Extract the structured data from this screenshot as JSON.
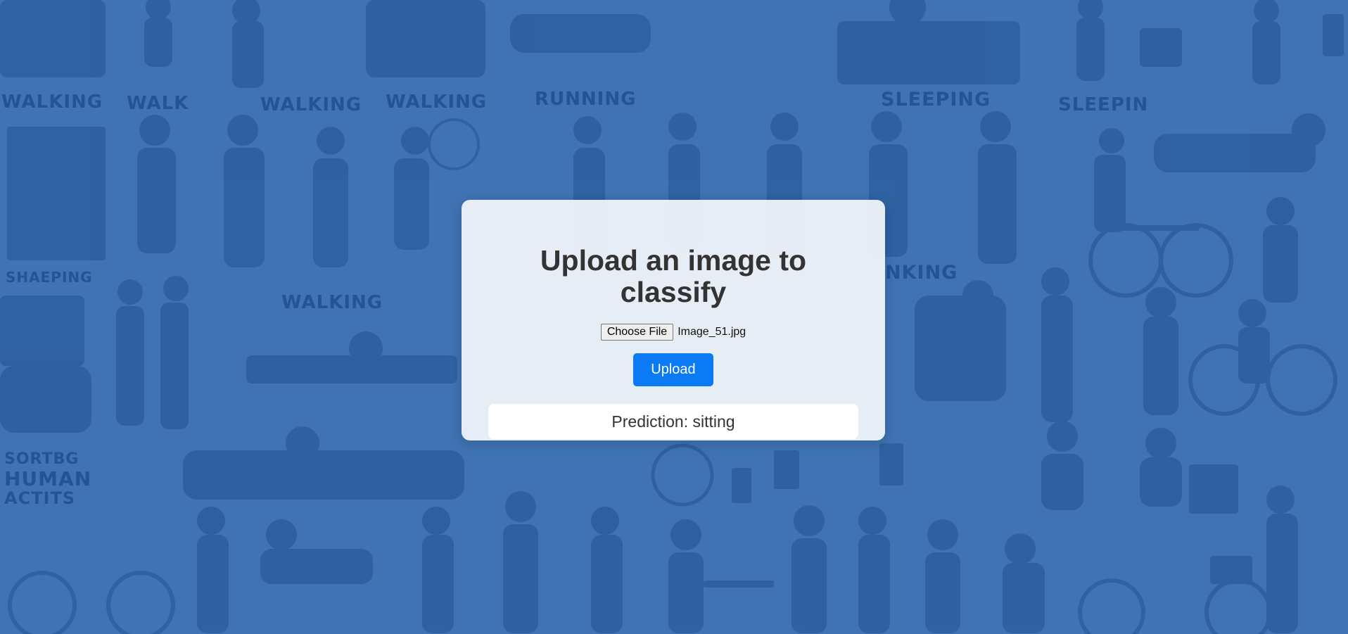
{
  "background": {
    "color": "#3f73b3",
    "words": [
      "WALKING",
      "WALK",
      "WALKING",
      "WALKING",
      "RUNNING",
      "SLEEPING",
      "SLEEPIN",
      "SHAEPING",
      "WALKING",
      "NKING",
      "SORTBG",
      "HUMAN",
      "ACTITS"
    ]
  },
  "card": {
    "title": "Upload an image to classify",
    "file_input": {
      "button_label": "Choose File",
      "file_name": "Image_51.jpg"
    },
    "upload_label": "Upload",
    "prediction_text": "Prediction: sitting",
    "accent_color": "#0a7bf5"
  }
}
